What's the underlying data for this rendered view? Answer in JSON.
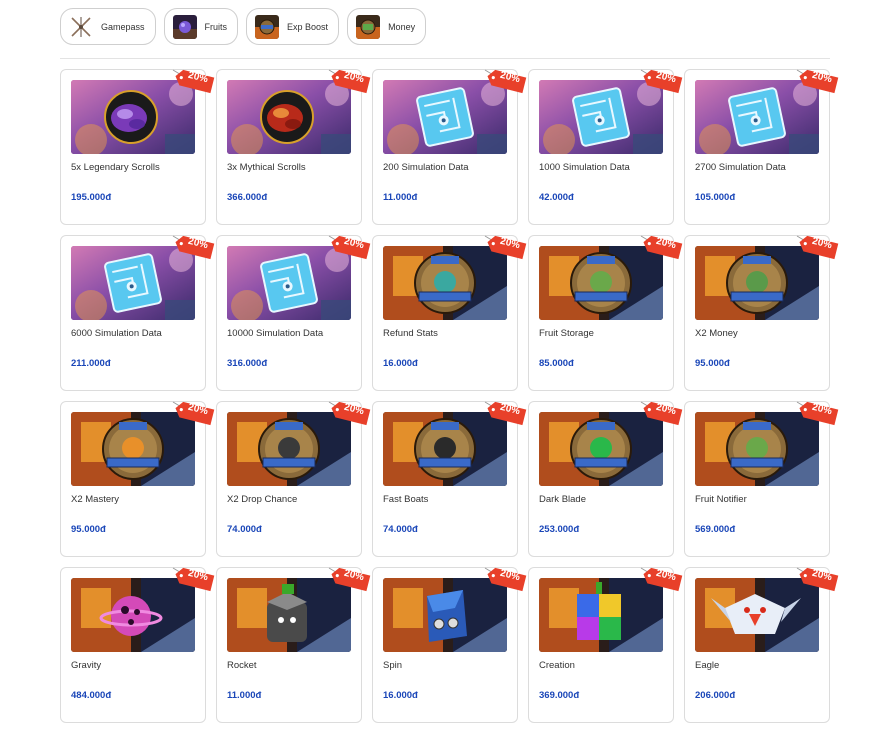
{
  "tabs": [
    {
      "label": "Gamepass",
      "icon": "crossed-swords-icon"
    },
    {
      "label": "Fruits",
      "icon": "fruit-thumb-icon"
    },
    {
      "label": "Exp Boost",
      "icon": "exp-boost-thumb-icon"
    },
    {
      "label": "Money",
      "icon": "money-thumb-icon"
    }
  ],
  "discount_label": "20%",
  "products": [
    {
      "name": "5x Legendary Scrolls",
      "price": "195.000đ",
      "art": "scroll-purple"
    },
    {
      "name": "3x Mythical Scrolls",
      "price": "366.000đ",
      "art": "scroll-red"
    },
    {
      "name": "200 Simulation Data",
      "price": "11.000đ",
      "art": "chip"
    },
    {
      "name": "1000 Simulation Data",
      "price": "42.000đ",
      "art": "chip"
    },
    {
      "name": "2700 Simulation Data",
      "price": "105.000đ",
      "art": "chip"
    },
    {
      "name": "6000 Simulation Data",
      "price": "211.000đ",
      "art": "chip"
    },
    {
      "name": "10000 Simulation Data",
      "price": "316.000đ",
      "art": "chip"
    },
    {
      "name": "Refund Stats",
      "price": "16.000đ",
      "art": "badge-teal",
      "badge_text": "STAT RESET"
    },
    {
      "name": "Fruit Storage",
      "price": "85.000đ",
      "art": "badge-chest",
      "badge_text": "FRUIT NOTIFIER"
    },
    {
      "name": "X2 Money",
      "price": "95.000đ",
      "art": "badge-money",
      "badge_text": "2X MONEY"
    },
    {
      "name": "X2 Mastery",
      "price": "95.000đ",
      "art": "badge-mastery",
      "badge_text": "2X MASTERY"
    },
    {
      "name": "X2 Drop Chance",
      "price": "74.000đ",
      "art": "badge-drop",
      "badge_text": "2X BOSS DROPS"
    },
    {
      "name": "Fast Boats",
      "price": "74.000đ",
      "art": "badge-boat",
      "badge_text": "FAST BOATS"
    },
    {
      "name": "Dark Blade",
      "price": "253.000đ",
      "art": "badge-blade",
      "badge_text": "DARK BLADE"
    },
    {
      "name": "Fruit Notifier",
      "price": "569.000đ",
      "art": "badge-chest",
      "badge_text": "FRUIT NOTIFIER"
    },
    {
      "name": "Gravity",
      "price": "484.000đ",
      "art": "fruit-gravity"
    },
    {
      "name": "Rocket",
      "price": "11.000đ",
      "art": "fruit-rocket"
    },
    {
      "name": "Spin",
      "price": "16.000đ",
      "art": "fruit-spin"
    },
    {
      "name": "Creation",
      "price": "369.000đ",
      "art": "fruit-creation"
    },
    {
      "name": "Eagle",
      "price": "206.000đ",
      "art": "fruit-eagle"
    }
  ],
  "colors": {
    "price": "#1a46b8",
    "discount_tag": "#e8402a",
    "card_border": "#dcdcdc"
  }
}
